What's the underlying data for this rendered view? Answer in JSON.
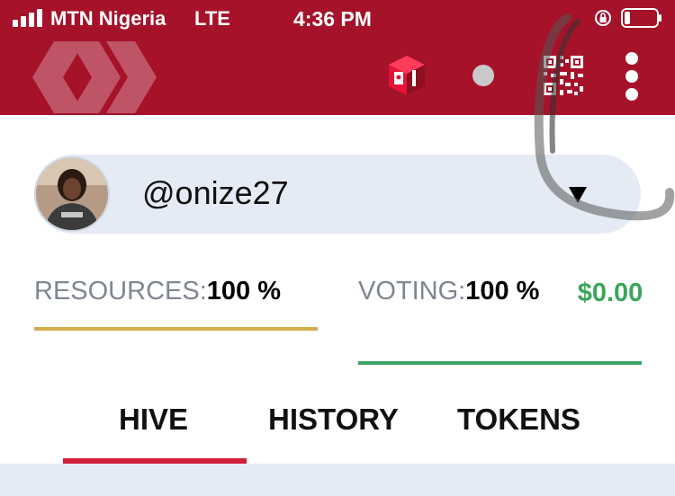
{
  "status_bar": {
    "carrier": "MTN Nigeria",
    "network": "LTE",
    "time": "4:36 PM"
  },
  "header": {
    "icons": [
      "hive-logo",
      "keychain-icon",
      "status-dot",
      "qr-code-icon",
      "more-vertical-icon"
    ],
    "background_color": "#a51229"
  },
  "account": {
    "username": "@onize27"
  },
  "stats": {
    "resources_label": "RESOURCES:",
    "resources_value": "100 %",
    "voting_label": "VOTING:",
    "voting_value": "100 %",
    "voting_amount": "$0.00",
    "resources_color": "#d2ae4a",
    "voting_color": "#3da466"
  },
  "tabs": [
    {
      "label": "HIVE",
      "active": true
    },
    {
      "label": "HISTORY",
      "active": false
    },
    {
      "label": "TOKENS",
      "active": false
    }
  ],
  "colors": {
    "accent": "#d01f3a",
    "amount_green": "#3aa65a",
    "panel": "#e5ebf4"
  }
}
